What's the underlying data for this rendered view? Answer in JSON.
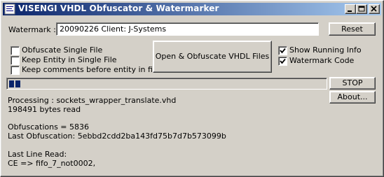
{
  "window": {
    "title": "VISENGI VHDL Obfuscator & Watermarker"
  },
  "watermark": {
    "label": "Watermark :",
    "value": "20090226 Client: J-Systems",
    "reset_label": "Reset"
  },
  "options_left": [
    {
      "label": "Obfuscate Single File",
      "checked": false
    },
    {
      "label": "Keep Entity in Single File",
      "checked": false
    },
    {
      "label": "Keep comments before entity in files",
      "checked": false
    }
  ],
  "main_button": {
    "label": "Open & Obfuscate VHDL Files"
  },
  "options_right": [
    {
      "label": "Show Running Info",
      "checked": true
    },
    {
      "label": "Watermark Code",
      "checked": true
    }
  ],
  "progress": {
    "segments_filled": 2
  },
  "stop_label": "STOP",
  "about_label": "About...",
  "output": {
    "line1": "Processing : sockets_wrapper_translate.vhd",
    "line2": "198491 bytes read",
    "line3": "Obfuscations = 5836",
    "line4": "Last Obfuscation: 5ebbd2cdd2ba143fd75b7d7b573099b",
    "line5": "Last Line Read:",
    "line6": "CE => fifo_7_not0002,"
  }
}
